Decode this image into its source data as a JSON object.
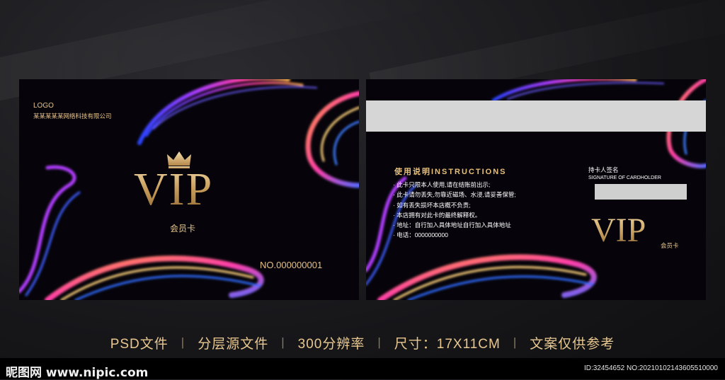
{
  "front": {
    "logo": "LOGO",
    "company": "某某某某某网络科技有限公司",
    "vip": "VIP",
    "member_label": "会员卡",
    "card_number": "NO.000000001"
  },
  "back": {
    "instructions_title": "使用说明INSTRUCTIONS",
    "rules": [
      "· 此卡只限本人使用,请在结账前出示;",
      "· 此卡请勿丢失,勿靠近磁场、水浸,请妥善保管;",
      "· 如有丢失损坏本店概不负责;",
      "· 本店拥有对此卡的最终解释权。",
      "· 地址：自行加入具体地址自行加入具体地址",
      "· 电话：0000000000"
    ],
    "signature_cn": "持卡人签名",
    "signature_en": "SIGNATURE OF CARDHOLDER",
    "vip": "VIP",
    "member_label": "会员卡"
  },
  "infobar": {
    "items": [
      "PSD文件",
      "分层源文件",
      "300分辨率",
      "尺寸：17X11CM",
      "文案仅供参考"
    ],
    "separator": "|"
  },
  "footer": {
    "watermark": "昵图网 www.nipic.com",
    "id_text": "ID:32454652 NO:20210102143605510000"
  },
  "colors": {
    "gold": "#d9b27a",
    "card_bg": "#06040a",
    "page_bg": "#1c1c1f"
  }
}
